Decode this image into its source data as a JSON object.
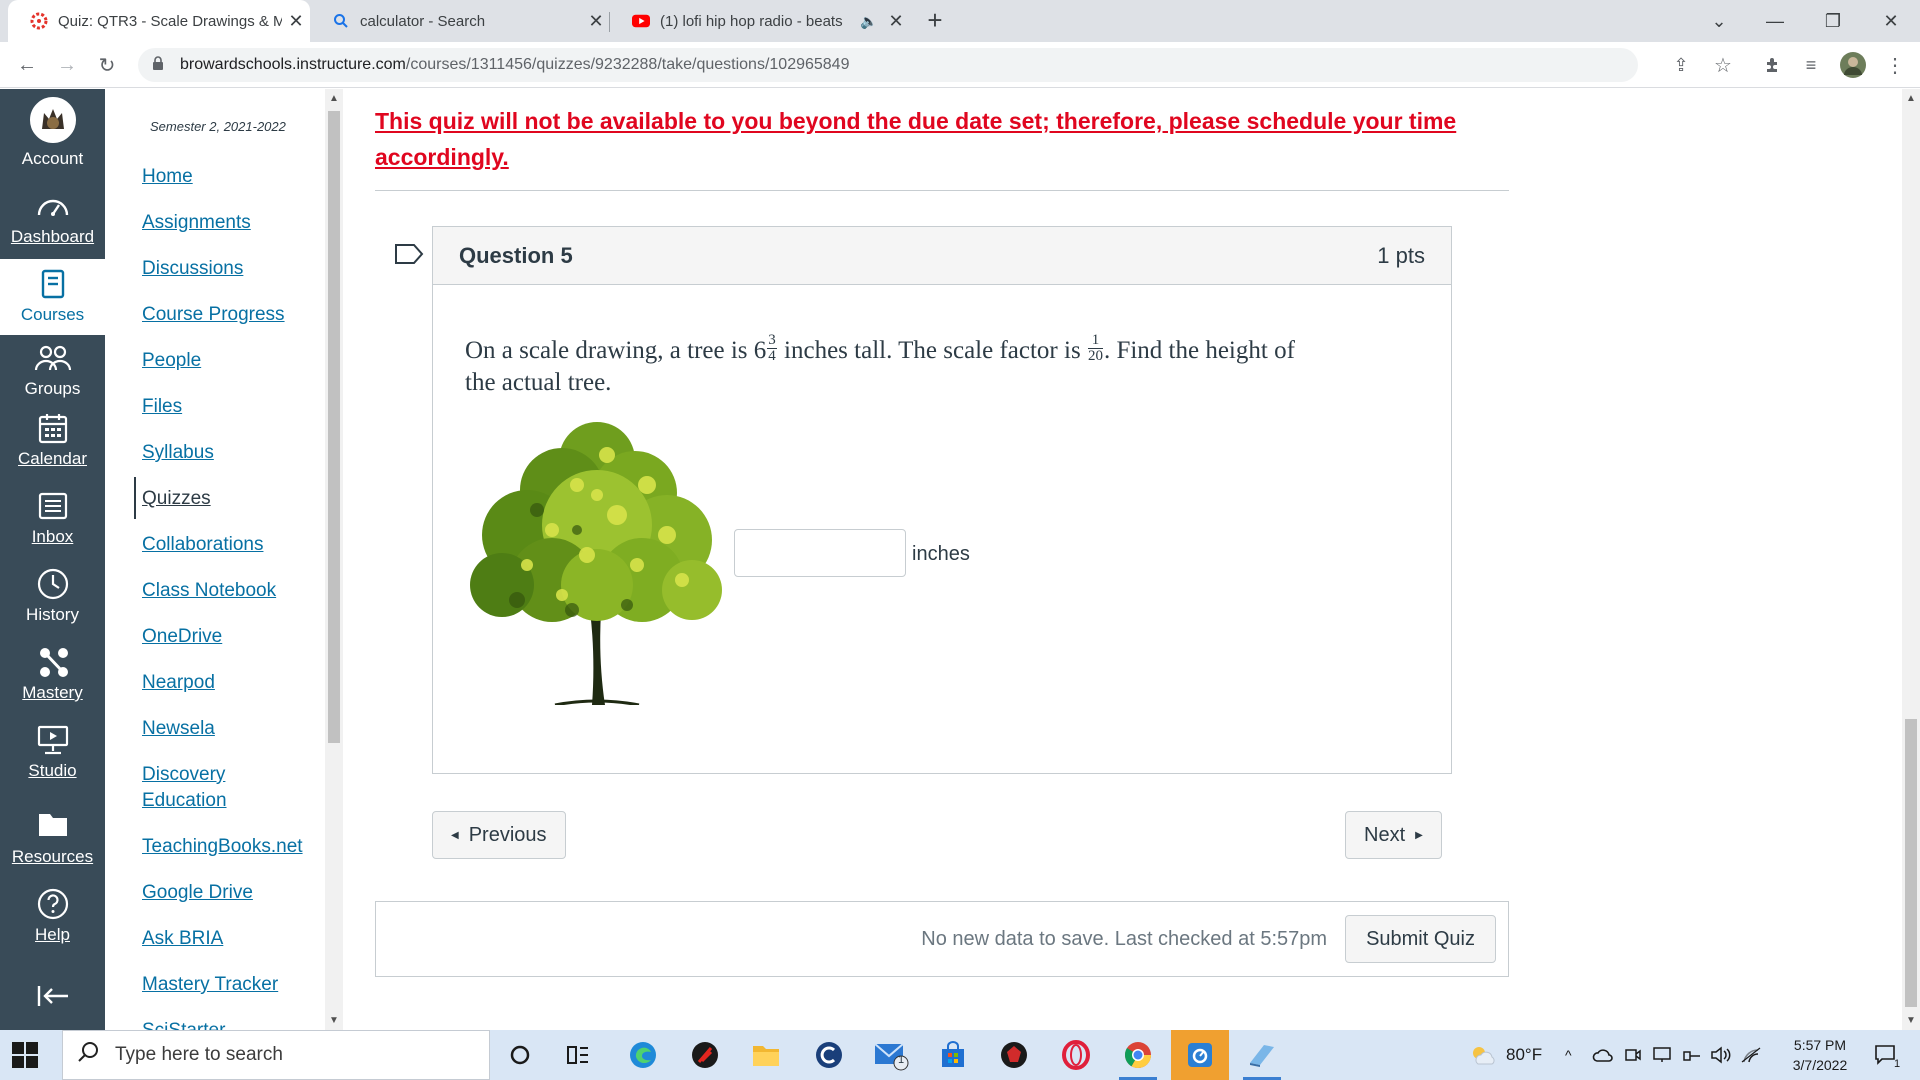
{
  "browser": {
    "tabs": [
      {
        "title": "Quiz: QTR3 - Scale Drawings & M",
        "active": true
      },
      {
        "title": "calculator - Search",
        "active": false
      },
      {
        "title": "(1) lofi hip hop radio - beats",
        "active": false
      }
    ],
    "url_host": "browardschools.instructure.com",
    "url_path": "/courses/1311456/quizzes/9232288/take/questions/102965849"
  },
  "global_nav": {
    "items": [
      {
        "label": "Account",
        "icon": "avatar"
      },
      {
        "label": "Dashboard",
        "icon": "dashboard-icon"
      },
      {
        "label": "Courses",
        "icon": "courses-icon"
      },
      {
        "label": "Groups",
        "icon": "groups-icon"
      },
      {
        "label": "Calendar",
        "icon": "calendar-icon"
      },
      {
        "label": "Inbox",
        "icon": "inbox-icon"
      },
      {
        "label": "History",
        "icon": "history-icon"
      },
      {
        "label": "Mastery",
        "icon": "mastery-icon"
      },
      {
        "label": "Studio",
        "icon": "studio-icon"
      },
      {
        "label": "Resources",
        "icon": "folder-icon"
      },
      {
        "label": "Help",
        "icon": "help-icon"
      }
    ]
  },
  "course_nav": {
    "semester": "Semester 2, 2021-2022",
    "links": [
      "Home",
      "Assignments",
      "Discussions",
      "Course Progress",
      "People",
      "Files",
      "Syllabus",
      "Quizzes",
      "Collaborations",
      "Class Notebook",
      "OneDrive",
      "Nearpod",
      "Newsela",
      "Discovery Education",
      "TeachingBooks.net",
      "Google Drive",
      "Ask BRIA",
      "Mastery Tracker",
      "SciStarter"
    ],
    "active": "Quizzes"
  },
  "quiz": {
    "warning": "This quiz will not be available to you beyond the due date set; therefore, please schedule your time accordingly.",
    "question_title": "Question 5",
    "points": "1 pts",
    "text_part1": "On a scale drawing, a tree is 6",
    "frac1_num": "3",
    "frac1_den": "4",
    "text_part2": " inches tall. The scale factor is ",
    "frac2_num": "1",
    "frac2_den": "20",
    "text_part3": ". Find the height of the actual tree.",
    "answer_value": "",
    "units": "inches",
    "previous_label": "Previous",
    "next_label": "Next",
    "save_message": "No new data to save. Last checked at 5:57pm",
    "submit_label": "Submit Quiz"
  },
  "taskbar": {
    "search_placeholder": "Type here to search",
    "weather": "80°F",
    "time": "5:57 PM",
    "date": "3/7/2022",
    "mail_badge": "1",
    "notif_badge": "1"
  },
  "colors": {
    "canvas_nav": "#394b58",
    "link": "#0770a3",
    "warning": "#e0061f"
  }
}
